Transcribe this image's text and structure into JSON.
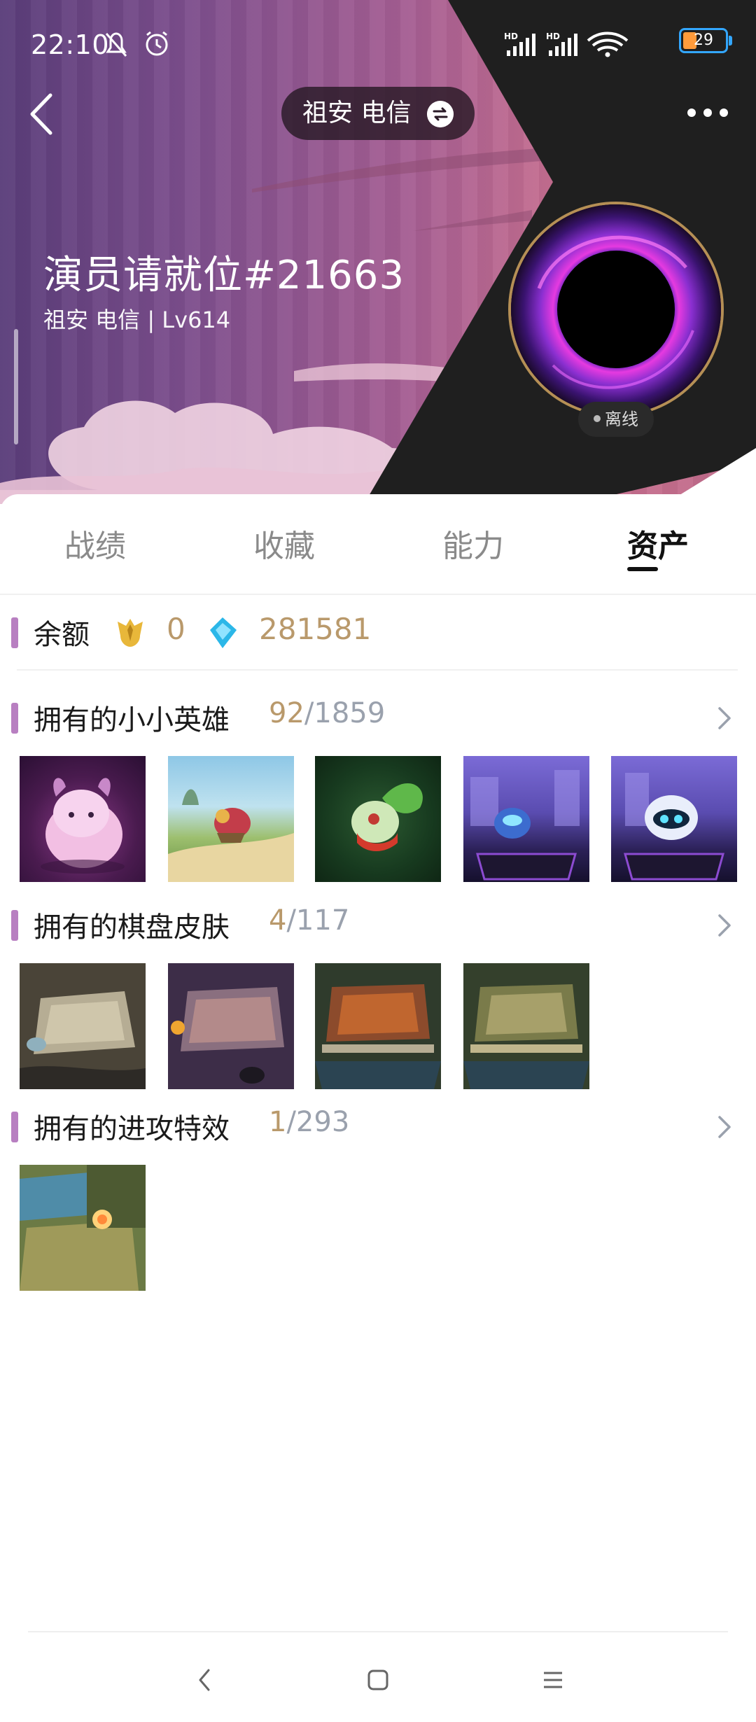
{
  "status_bar": {
    "time": "22:10",
    "battery": "29",
    "signal_1": "HD",
    "signal_2": "HD"
  },
  "header": {
    "server_pill": "祖安 电信",
    "player_name": "演员请就位#21663",
    "player_sub": "祖安 电信 | Lv614",
    "status_badge": "离线"
  },
  "tabs": [
    {
      "label": "战绩",
      "active": false
    },
    {
      "label": "收藏",
      "active": false
    },
    {
      "label": "能力",
      "active": false
    },
    {
      "label": "资产",
      "active": true
    }
  ],
  "balance": {
    "title": "余额",
    "gold_amount": "0",
    "gem_amount": "281581"
  },
  "sections": {
    "heroes": {
      "title": "拥有的小小英雄",
      "owned": "92",
      "total": "/1859",
      "items": [
        "pink-horned-creature",
        "bird-on-road",
        "green-leaf-sprite",
        "blue-robot-arena",
        "blue-robot-arena-2"
      ]
    },
    "boards": {
      "title": "拥有的棋盘皮肤",
      "owned": "4",
      "total": "/117",
      "items": [
        "stone-board",
        "volcanic-board",
        "lava-board",
        "forest-board"
      ]
    },
    "effects": {
      "title": "拥有的进攻特效",
      "owned": "1",
      "total": "/293",
      "items": [
        "attack-effect-board"
      ]
    }
  },
  "colors": {
    "accent_bar": "#b87fc1",
    "owned_gold": "#b9996b",
    "total_grey": "#9aa1ad"
  }
}
